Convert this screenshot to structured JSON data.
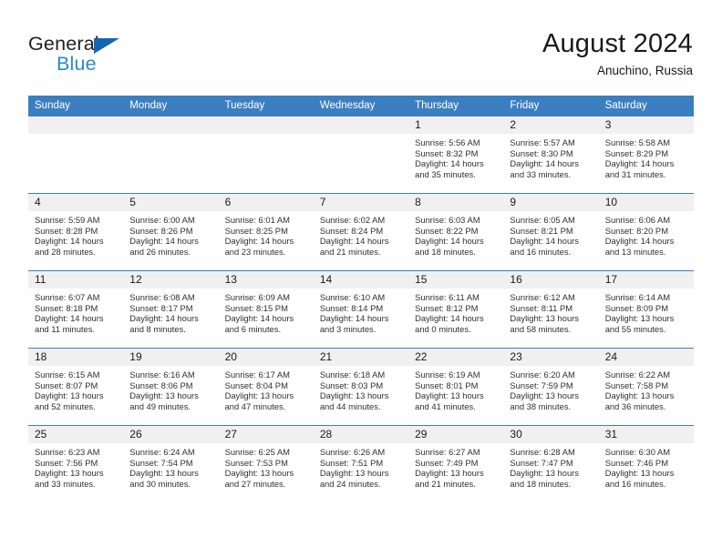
{
  "brand": {
    "name_part1": "General",
    "name_part2": "Blue",
    "triangle_color": "#1565b0",
    "blue_color": "#2b87d3"
  },
  "header": {
    "title": "August 2024",
    "subtitle": "Anuchino, Russia"
  },
  "theme": {
    "header_row_bg": "#3c7fc1",
    "day_number_bg": "#f0f0f0",
    "row_divider": "#3c7fc1"
  },
  "calendar": {
    "weekday_headers": [
      "Sunday",
      "Monday",
      "Tuesday",
      "Wednesday",
      "Thursday",
      "Friday",
      "Saturday"
    ],
    "weeks": [
      [
        {
          "day": "",
          "lines": []
        },
        {
          "day": "",
          "lines": []
        },
        {
          "day": "",
          "lines": []
        },
        {
          "day": "",
          "lines": []
        },
        {
          "day": "1",
          "lines": [
            "Sunrise: 5:56 AM",
            "Sunset: 8:32 PM",
            "Daylight: 14 hours",
            "and 35 minutes."
          ]
        },
        {
          "day": "2",
          "lines": [
            "Sunrise: 5:57 AM",
            "Sunset: 8:30 PM",
            "Daylight: 14 hours",
            "and 33 minutes."
          ]
        },
        {
          "day": "3",
          "lines": [
            "Sunrise: 5:58 AM",
            "Sunset: 8:29 PM",
            "Daylight: 14 hours",
            "and 31 minutes."
          ]
        }
      ],
      [
        {
          "day": "4",
          "lines": [
            "Sunrise: 5:59 AM",
            "Sunset: 8:28 PM",
            "Daylight: 14 hours",
            "and 28 minutes."
          ]
        },
        {
          "day": "5",
          "lines": [
            "Sunrise: 6:00 AM",
            "Sunset: 8:26 PM",
            "Daylight: 14 hours",
            "and 26 minutes."
          ]
        },
        {
          "day": "6",
          "lines": [
            "Sunrise: 6:01 AM",
            "Sunset: 8:25 PM",
            "Daylight: 14 hours",
            "and 23 minutes."
          ]
        },
        {
          "day": "7",
          "lines": [
            "Sunrise: 6:02 AM",
            "Sunset: 8:24 PM",
            "Daylight: 14 hours",
            "and 21 minutes."
          ]
        },
        {
          "day": "8",
          "lines": [
            "Sunrise: 6:03 AM",
            "Sunset: 8:22 PM",
            "Daylight: 14 hours",
            "and 18 minutes."
          ]
        },
        {
          "day": "9",
          "lines": [
            "Sunrise: 6:05 AM",
            "Sunset: 8:21 PM",
            "Daylight: 14 hours",
            "and 16 minutes."
          ]
        },
        {
          "day": "10",
          "lines": [
            "Sunrise: 6:06 AM",
            "Sunset: 8:20 PM",
            "Daylight: 14 hours",
            "and 13 minutes."
          ]
        }
      ],
      [
        {
          "day": "11",
          "lines": [
            "Sunrise: 6:07 AM",
            "Sunset: 8:18 PM",
            "Daylight: 14 hours",
            "and 11 minutes."
          ]
        },
        {
          "day": "12",
          "lines": [
            "Sunrise: 6:08 AM",
            "Sunset: 8:17 PM",
            "Daylight: 14 hours",
            "and 8 minutes."
          ]
        },
        {
          "day": "13",
          "lines": [
            "Sunrise: 6:09 AM",
            "Sunset: 8:15 PM",
            "Daylight: 14 hours",
            "and 6 minutes."
          ]
        },
        {
          "day": "14",
          "lines": [
            "Sunrise: 6:10 AM",
            "Sunset: 8:14 PM",
            "Daylight: 14 hours",
            "and 3 minutes."
          ]
        },
        {
          "day": "15",
          "lines": [
            "Sunrise: 6:11 AM",
            "Sunset: 8:12 PM",
            "Daylight: 14 hours",
            "and 0 minutes."
          ]
        },
        {
          "day": "16",
          "lines": [
            "Sunrise: 6:12 AM",
            "Sunset: 8:11 PM",
            "Daylight: 13 hours",
            "and 58 minutes."
          ]
        },
        {
          "day": "17",
          "lines": [
            "Sunrise: 6:14 AM",
            "Sunset: 8:09 PM",
            "Daylight: 13 hours",
            "and 55 minutes."
          ]
        }
      ],
      [
        {
          "day": "18",
          "lines": [
            "Sunrise: 6:15 AM",
            "Sunset: 8:07 PM",
            "Daylight: 13 hours",
            "and 52 minutes."
          ]
        },
        {
          "day": "19",
          "lines": [
            "Sunrise: 6:16 AM",
            "Sunset: 8:06 PM",
            "Daylight: 13 hours",
            "and 49 minutes."
          ]
        },
        {
          "day": "20",
          "lines": [
            "Sunrise: 6:17 AM",
            "Sunset: 8:04 PM",
            "Daylight: 13 hours",
            "and 47 minutes."
          ]
        },
        {
          "day": "21",
          "lines": [
            "Sunrise: 6:18 AM",
            "Sunset: 8:03 PM",
            "Daylight: 13 hours",
            "and 44 minutes."
          ]
        },
        {
          "day": "22",
          "lines": [
            "Sunrise: 6:19 AM",
            "Sunset: 8:01 PM",
            "Daylight: 13 hours",
            "and 41 minutes."
          ]
        },
        {
          "day": "23",
          "lines": [
            "Sunrise: 6:20 AM",
            "Sunset: 7:59 PM",
            "Daylight: 13 hours",
            "and 38 minutes."
          ]
        },
        {
          "day": "24",
          "lines": [
            "Sunrise: 6:22 AM",
            "Sunset: 7:58 PM",
            "Daylight: 13 hours",
            "and 36 minutes."
          ]
        }
      ],
      [
        {
          "day": "25",
          "lines": [
            "Sunrise: 6:23 AM",
            "Sunset: 7:56 PM",
            "Daylight: 13 hours",
            "and 33 minutes."
          ]
        },
        {
          "day": "26",
          "lines": [
            "Sunrise: 6:24 AM",
            "Sunset: 7:54 PM",
            "Daylight: 13 hours",
            "and 30 minutes."
          ]
        },
        {
          "day": "27",
          "lines": [
            "Sunrise: 6:25 AM",
            "Sunset: 7:53 PM",
            "Daylight: 13 hours",
            "and 27 minutes."
          ]
        },
        {
          "day": "28",
          "lines": [
            "Sunrise: 6:26 AM",
            "Sunset: 7:51 PM",
            "Daylight: 13 hours",
            "and 24 minutes."
          ]
        },
        {
          "day": "29",
          "lines": [
            "Sunrise: 6:27 AM",
            "Sunset: 7:49 PM",
            "Daylight: 13 hours",
            "and 21 minutes."
          ]
        },
        {
          "day": "30",
          "lines": [
            "Sunrise: 6:28 AM",
            "Sunset: 7:47 PM",
            "Daylight: 13 hours",
            "and 18 minutes."
          ]
        },
        {
          "day": "31",
          "lines": [
            "Sunrise: 6:30 AM",
            "Sunset: 7:46 PM",
            "Daylight: 13 hours",
            "and 16 minutes."
          ]
        }
      ]
    ]
  }
}
